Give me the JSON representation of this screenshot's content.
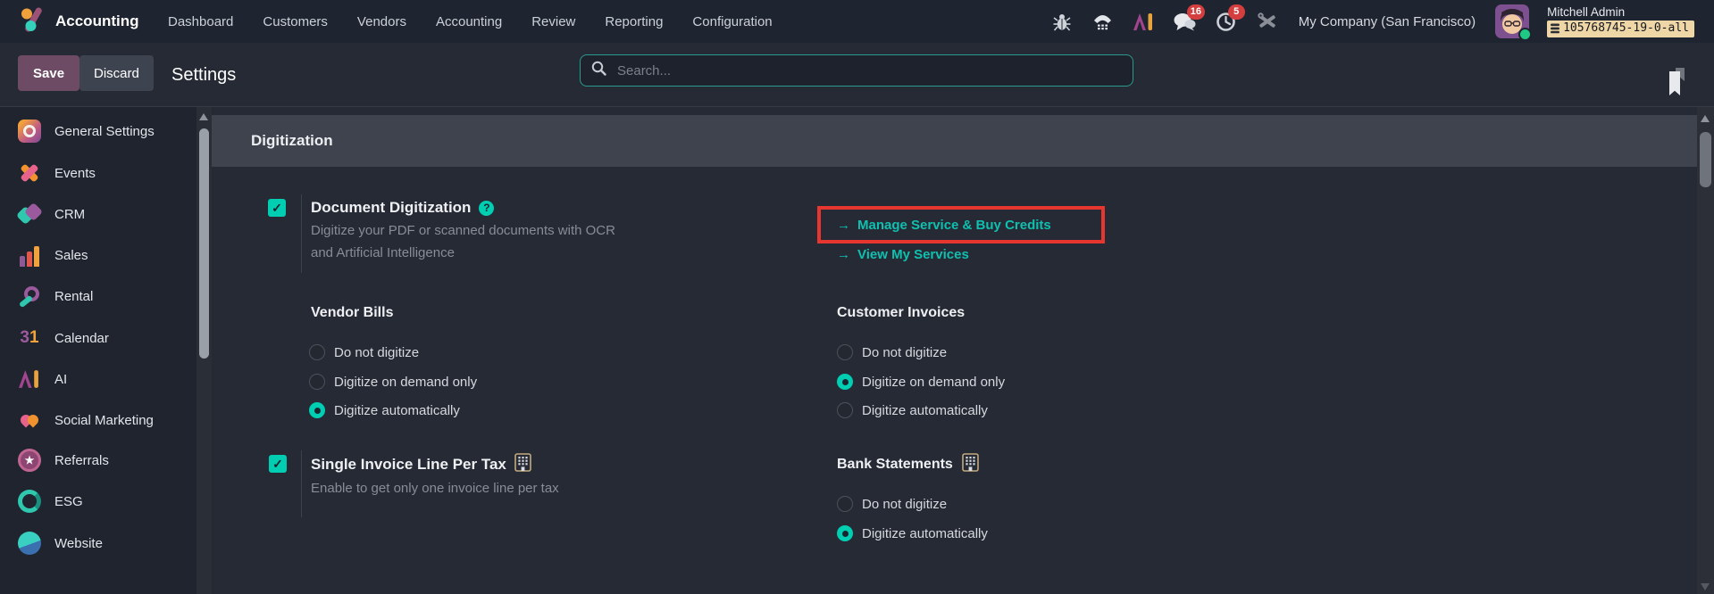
{
  "topnav": {
    "app_name": "Accounting",
    "menu": [
      "Dashboard",
      "Customers",
      "Vendors",
      "Accounting",
      "Review",
      "Reporting",
      "Configuration"
    ],
    "message_badge": "16",
    "activity_badge": "5",
    "company_name": "My Company (San Francisco)",
    "user_name": "Mitchell Admin",
    "database_ref": "105768745-19-0-all"
  },
  "controlbar": {
    "save_label": "Save",
    "discard_label": "Discard",
    "page_title": "Settings",
    "search_placeholder": "Search..."
  },
  "sidebar": {
    "items": [
      {
        "label": "General Settings"
      },
      {
        "label": "Events"
      },
      {
        "label": "CRM"
      },
      {
        "label": "Sales"
      },
      {
        "label": "Rental"
      },
      {
        "label": "Calendar",
        "icon_glyph_1": "3",
        "icon_glyph_2": "1"
      },
      {
        "label": "AI"
      },
      {
        "label": "Social Marketing"
      },
      {
        "label": "Referrals"
      },
      {
        "label": "ESG"
      },
      {
        "label": "Website"
      }
    ]
  },
  "content": {
    "section_title": "Digitization",
    "document_digitization": {
      "label": "Document Digitization",
      "help_glyph": "?",
      "description": "Digitize your PDF or scanned documents with OCR and Artificial Intelligence",
      "checked": true
    },
    "links": {
      "arrow_glyph": "→",
      "manage_service": "Manage Service & Buy Credits",
      "view_services": "View My Services"
    },
    "vendor_bills": {
      "label": "Vendor Bills",
      "options": [
        "Do not digitize",
        "Digitize on demand only",
        "Digitize automatically"
      ],
      "selected_index": 2
    },
    "customer_invoices": {
      "label": "Customer Invoices",
      "options": [
        "Do not digitize",
        "Digitize on demand only",
        "Digitize automatically"
      ],
      "selected_index": 1
    },
    "single_invoice_line": {
      "label": "Single Invoice Line Per Tax",
      "description": "Enable to get only one invoice line per tax",
      "checked": true
    },
    "bank_statements": {
      "label": "Bank Statements",
      "options": [
        "Do not digitize",
        "Digitize automatically"
      ],
      "selected_index": 1
    }
  },
  "colors": {
    "accent_teal": "#00ceb3",
    "link_teal": "#0fc0b0",
    "highlight_red": "#e73530",
    "save_purple": "#6e4b64",
    "badge_red": "#d53e3e",
    "db_badge_tan": "#efd6a6",
    "enterprise_gold": "#c2a97e",
    "topnav_bg": "#1e2430",
    "content_bg": "#262a34"
  }
}
